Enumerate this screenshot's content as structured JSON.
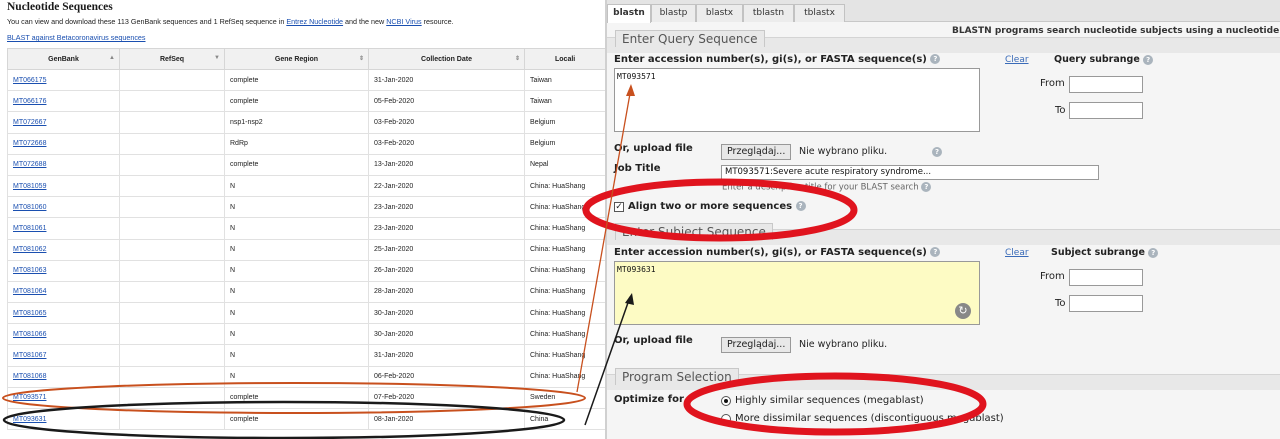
{
  "left": {
    "title": "Nucleotide Sequences",
    "desc_prefix": "You can view and download these 113 GenBank sequences and 1 RefSeq sequence in ",
    "desc_link1": "Entrez Nucleotide",
    "desc_mid": " and the new ",
    "desc_link2": "NCBI Virus",
    "desc_suffix": " resource.",
    "blast_link": "BLAST against Betacoronavirus sequences",
    "columns": [
      "GenBank",
      "RefSeq",
      "Gene Region",
      "Collection Date",
      "Locali"
    ],
    "rows": [
      {
        "acc": "MT066175",
        "refseq": "",
        "region": "complete",
        "date": "31-Jan-2020",
        "loc": "Taiwan"
      },
      {
        "acc": "MT066176",
        "refseq": "",
        "region": "complete",
        "date": "05-Feb-2020",
        "loc": "Taiwan"
      },
      {
        "acc": "MT072667",
        "refseq": "",
        "region": "nsp1-nsp2",
        "date": "03-Feb-2020",
        "loc": "Belgium"
      },
      {
        "acc": "MT072668",
        "refseq": "",
        "region": "RdRp",
        "date": "03-Feb-2020",
        "loc": "Belgium"
      },
      {
        "acc": "MT072688",
        "refseq": "",
        "region": "complete",
        "date": "13-Jan-2020",
        "loc": "Nepal"
      },
      {
        "acc": "MT081059",
        "refseq": "",
        "region": "N",
        "date": "22-Jan-2020",
        "loc": "China: HuaShang"
      },
      {
        "acc": "MT081060",
        "refseq": "",
        "region": "N",
        "date": "23-Jan-2020",
        "loc": "China: HuaShang"
      },
      {
        "acc": "MT081061",
        "refseq": "",
        "region": "N",
        "date": "23-Jan-2020",
        "loc": "China: HuaShang"
      },
      {
        "acc": "MT081062",
        "refseq": "",
        "region": "N",
        "date": "25-Jan-2020",
        "loc": "China: HuaShang"
      },
      {
        "acc": "MT081063",
        "refseq": "",
        "region": "N",
        "date": "26-Jan-2020",
        "loc": "China: HuaShang"
      },
      {
        "acc": "MT081064",
        "refseq": "",
        "region": "N",
        "date": "28-Jan-2020",
        "loc": "China: HuaShang"
      },
      {
        "acc": "MT081065",
        "refseq": "",
        "region": "N",
        "date": "30-Jan-2020",
        "loc": "China: HuaShang"
      },
      {
        "acc": "MT081066",
        "refseq": "",
        "region": "N",
        "date": "30-Jan-2020",
        "loc": "China: HuaShang"
      },
      {
        "acc": "MT081067",
        "refseq": "",
        "region": "N",
        "date": "31-Jan-2020",
        "loc": "China: HuaShang"
      },
      {
        "acc": "MT081068",
        "refseq": "",
        "region": "N",
        "date": "06-Feb-2020",
        "loc": "China: HuaShang"
      },
      {
        "acc": "MT093571",
        "refseq": "",
        "region": "complete",
        "date": "07-Feb-2020",
        "loc": "Sweden"
      },
      {
        "acc": "MT093631",
        "refseq": "",
        "region": "complete",
        "date": "08-Jan-2020",
        "loc": "China"
      }
    ]
  },
  "right": {
    "tabs": [
      "blastn",
      "blastp",
      "blastx",
      "tblastn",
      "tblastx"
    ],
    "header_desc": "BLASTN programs search nucleotide subjects using a nucleotide query. m",
    "query": {
      "section": "Enter Query Sequence",
      "label": "Enter accession number(s), gi(s), or FASTA sequence(s)",
      "clear": "Clear",
      "subrange": "Query subrange",
      "value": "MT093571",
      "from": "From",
      "to": "To",
      "upload": "Or, upload file",
      "browse": "Przeglądaj...",
      "nofile": "Nie wybrano pliku.",
      "job_title": "Job Title",
      "job_value": "MT093571:Severe acute respiratory syndrome...",
      "job_hint": "Enter a descriptive title for your BLAST search",
      "align": "Align two or more sequences"
    },
    "subject": {
      "section": "Enter Subject Sequence",
      "label": "Enter accession number(s), gi(s), or FASTA sequence(s)",
      "clear": "Clear",
      "subrange": "Subject subrange",
      "value": "MT093631",
      "from": "From",
      "to": "To",
      "upload": "Or, upload file",
      "browse": "Przeglądaj...",
      "nofile": "Nie wybrano pliku."
    },
    "program": {
      "section": "Program Selection",
      "optimize": "Optimize for",
      "opt1": "Highly similar sequences (megablast)",
      "opt2": "More dissimilar sequences (discontiguous megablast)"
    }
  },
  "annotation_colors": {
    "red": "#e0141e",
    "orange": "#c8501e",
    "dark": "#1a1a1a"
  }
}
